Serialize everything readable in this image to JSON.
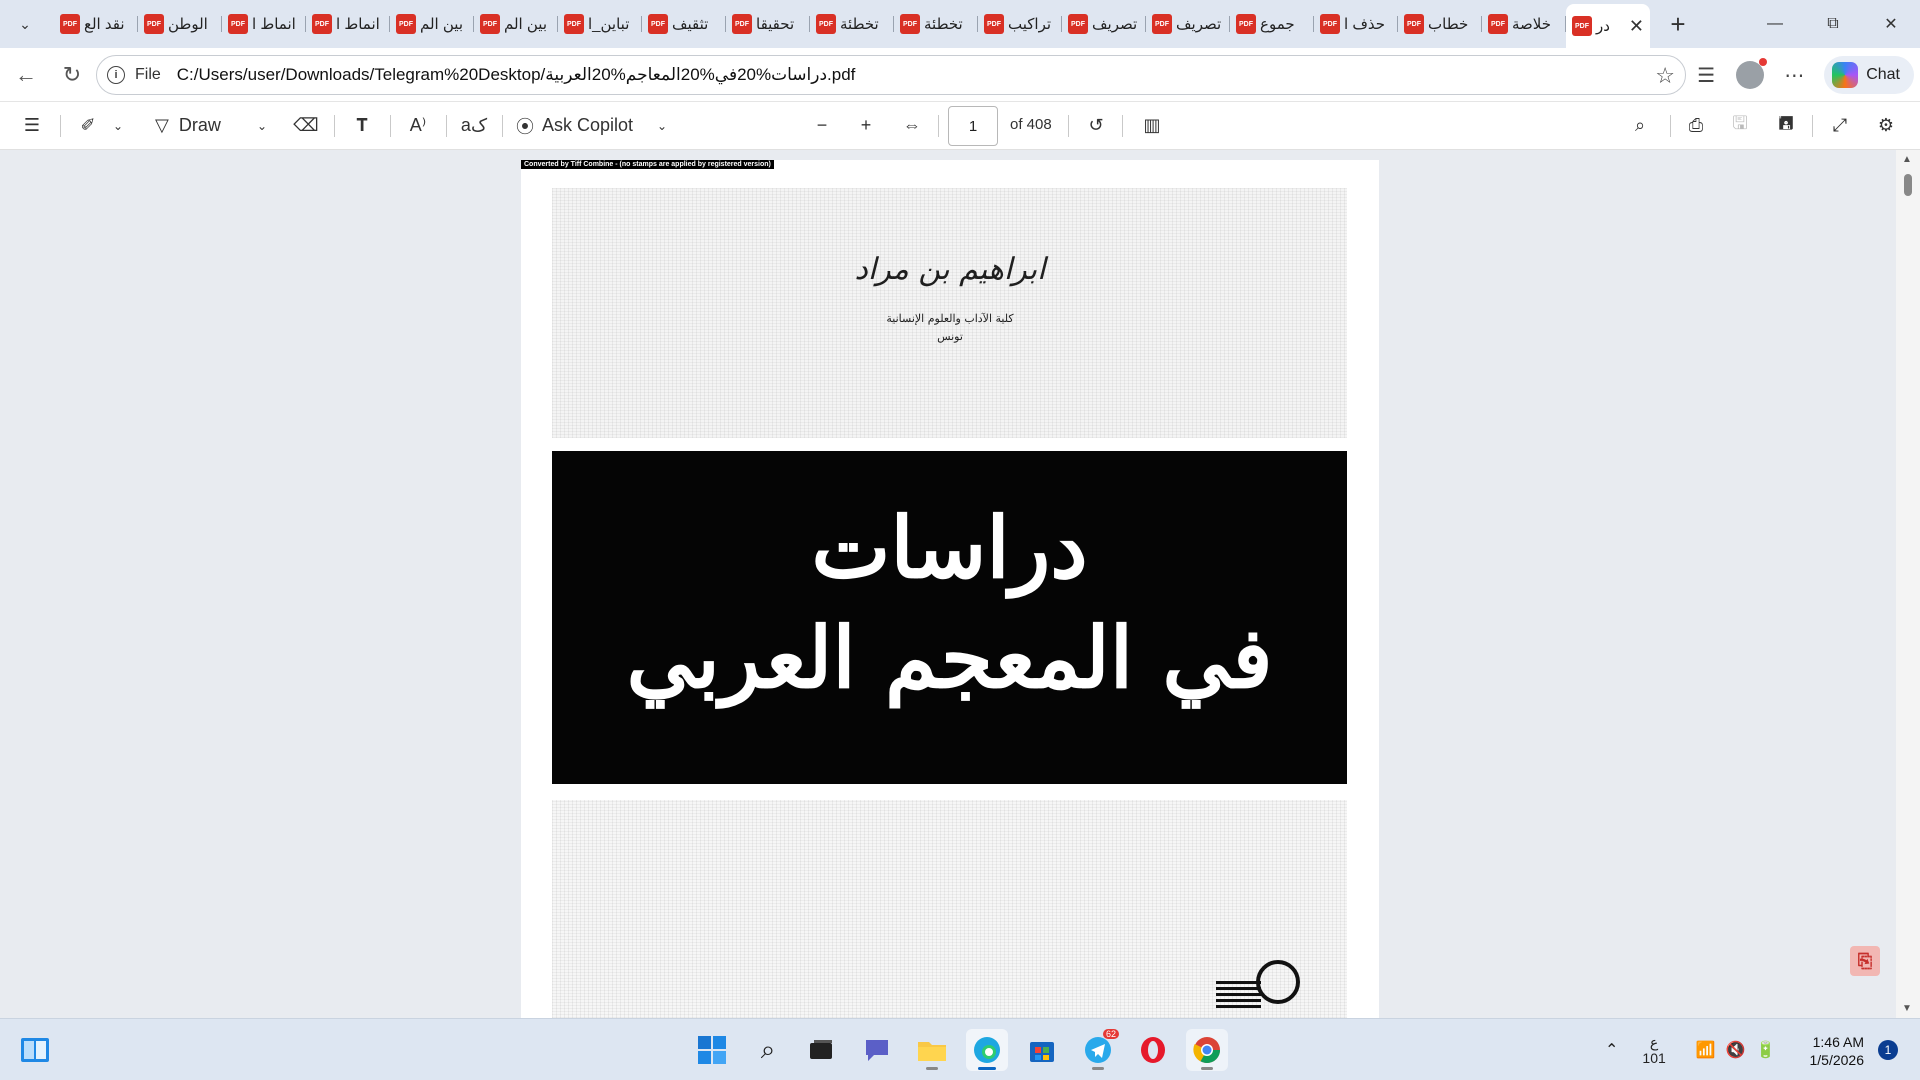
{
  "tabs": [
    {
      "label": "نقد الع",
      "active": false
    },
    {
      "label": "الوطن",
      "active": false
    },
    {
      "label": "انماط ا",
      "active": false
    },
    {
      "label": "انماط ا",
      "active": false
    },
    {
      "label": "بين الم",
      "active": false
    },
    {
      "label": "بين الم",
      "active": false
    },
    {
      "label": "تباين_ا",
      "active": false
    },
    {
      "label": "تثقيف",
      "active": false
    },
    {
      "label": "تحقيقا",
      "active": false
    },
    {
      "label": "تخطئة",
      "active": false
    },
    {
      "label": "تخطئة",
      "active": false
    },
    {
      "label": "تراكيب",
      "active": false
    },
    {
      "label": "تصريف",
      "active": false
    },
    {
      "label": "تصريف",
      "active": false
    },
    {
      "label": "جموع",
      "active": false
    },
    {
      "label": "حذف ا",
      "active": false
    },
    {
      "label": "خطاب",
      "active": false
    },
    {
      "label": "خلاصة",
      "active": false
    },
    {
      "label": "در",
      "active": true
    }
  ],
  "address": {
    "scheme_label": "File",
    "url": "C:/Users/user/Downloads/Telegram%20Desktop/دراسات%20في%20المعاجم%20العربية.pdf",
    "chat_label": "Chat"
  },
  "pdf_toolbar": {
    "draw_label": "Draw",
    "ask_copilot_label": "Ask Copilot",
    "page_number": "1",
    "page_total": "of 408"
  },
  "document": {
    "banner": "Converted by Tiff Combine - (no stamps are applied by registered version)",
    "author": "ابراهيم بن مراد",
    "affiliation_line1": "كلية الآداب والعلوم الإنسانية",
    "affiliation_line2": "تونس",
    "title_line1": "دراسات",
    "title_line2": "في المعجم العربي"
  },
  "taskbar": {
    "telegram_badge": "62",
    "lang_indicator": "ع",
    "lang_sub": "101",
    "time": "1:46 AM",
    "date": "1/5/2026",
    "notification_count": "1"
  }
}
